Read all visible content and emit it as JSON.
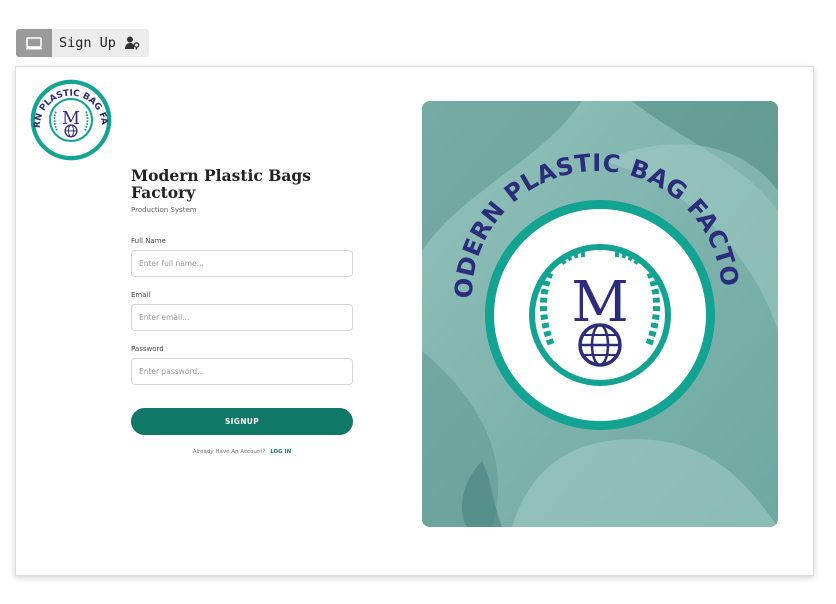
{
  "toolbar": {
    "device_icon": "monitor-icon",
    "tab_label": "Sign Up",
    "tab_icon": "user-key-icon"
  },
  "brand": {
    "logo_text_arc": "MODERN PLASTIC BAG FACTORY",
    "logo_monogram": "M",
    "name": "Modern Plastic Bags Factory",
    "subtitle": "Production System"
  },
  "form": {
    "full_name": {
      "label": "Full Name",
      "placeholder": "Enter full name..."
    },
    "email": {
      "label": "Email",
      "placeholder": "Enter email..."
    },
    "password": {
      "label": "Password",
      "placeholder": "Enter password..."
    },
    "submit_label": "SIGNUP",
    "login_prompt": "Already Have An Account?",
    "login_link": "LOG IN"
  },
  "colors": {
    "accent": "#0f7866",
    "logo_ring": "#13a392",
    "logo_text": "#2b2d7c",
    "panel_bg": "#7fb3ad"
  }
}
